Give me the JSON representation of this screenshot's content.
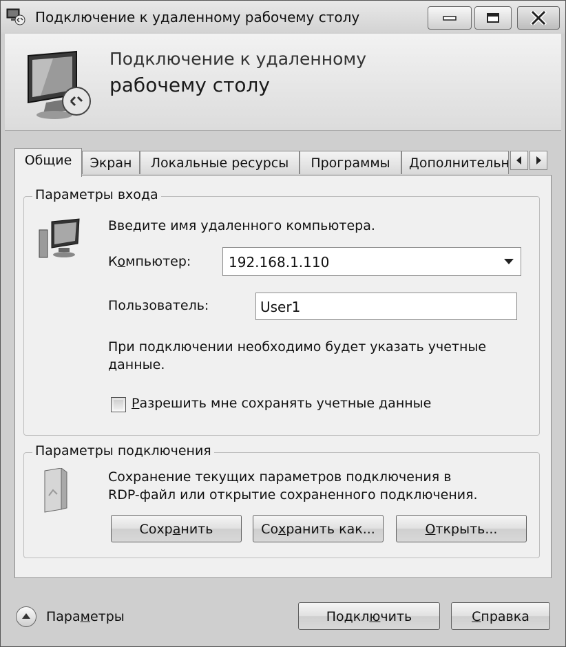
{
  "window": {
    "title": "Подключение к удаленному рабочему столу"
  },
  "header": {
    "line1": "Подключение к удаленному",
    "line2": "рабочему столу"
  },
  "tabs": [
    {
      "label": "Общие",
      "active": true
    },
    {
      "label": "Экран",
      "active": false
    },
    {
      "label": "Локальные ресурсы",
      "active": false
    },
    {
      "label": "Программы",
      "active": false
    },
    {
      "label": "Дополнительно",
      "active": false
    }
  ],
  "login_group": {
    "legend": "Параметры входа",
    "hint": "Введите имя удаленного компьютера.",
    "computer_label_prefix": "К",
    "computer_label_underlined": "о",
    "computer_label_rest": "мпьютер:",
    "computer_value": "192.168.1.110",
    "user_label": "Пользователь:",
    "user_value": "User1",
    "note_line1": "При подключении необходимо будет указать учетные",
    "note_line2": "данные.",
    "remember_underlined": "Р",
    "remember_rest": "азрешить мне сохранять учетные данные",
    "remember_checked": false
  },
  "connection_group": {
    "legend": "Параметры подключения",
    "desc_line1": "Сохранение текущих параметров подключения в",
    "desc_line2": "RDP-файл или открытие сохраненного подключения.",
    "save_a": "Сохр",
    "save_u": "а",
    "save_b": "нить",
    "saveas_a": "Со",
    "saveas_u": "х",
    "saveas_b": "ранить как...",
    "open_u": "О",
    "open_b": "ткрыть..."
  },
  "footer": {
    "options_a": "Пара",
    "options_u": "м",
    "options_b": "етры",
    "connect_a": "Подкл",
    "connect_u": "ю",
    "connect_b": "чить",
    "help_u": "С",
    "help_b": "правка"
  }
}
